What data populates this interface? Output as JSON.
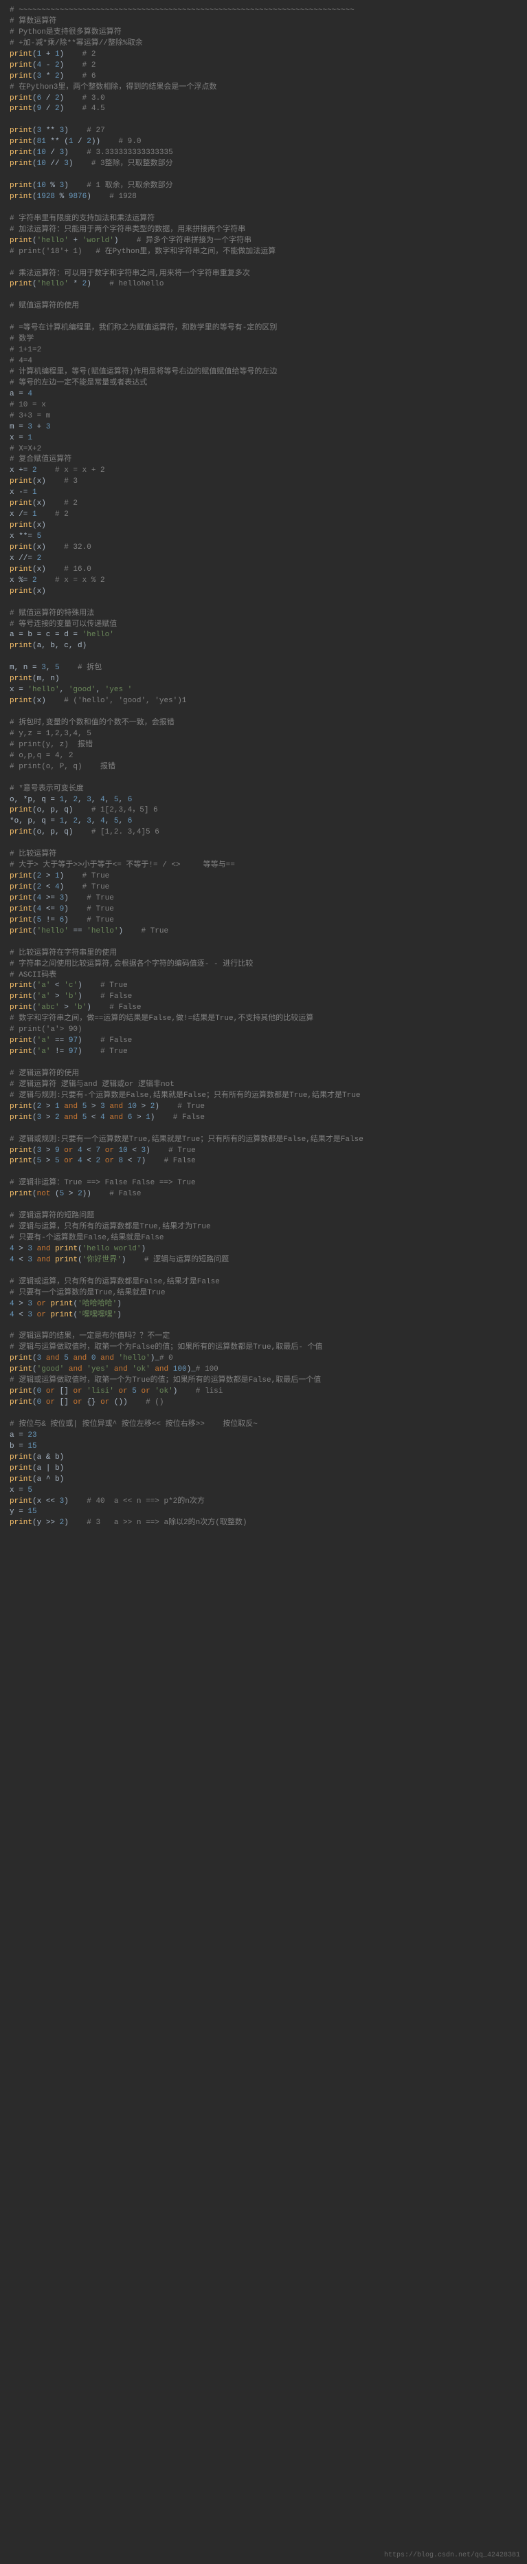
{
  "watermark": "https://blog.csdn.net/qq_42428381",
  "lines": [
    {
      "t": "cmt",
      "v": "# ~~~~~~~~~~~~~~~~~~~~~~~~~~~~~~~~~~~~~~~~~~~~~~~~~~~~~~~~~~~~~~~~~~~~~~~~~~"
    },
    {
      "t": "cmt",
      "v": "# 算数运算符"
    },
    {
      "t": "cmt",
      "v": "# Python是支持很多算数运算符"
    },
    {
      "t": "cmt",
      "v": "# +加-减*乘/除**幂运算//整除%取余"
    },
    {
      "t": "code",
      "v": "print(1 + 1)    # 2"
    },
    {
      "t": "code",
      "v": "print(4 - 2)    # 2"
    },
    {
      "t": "code",
      "v": "print(3 * 2)    # 6",
      "hl": [
        0,
        1
      ]
    },
    {
      "t": "cmt",
      "v": "# 在Python3里，两个整数相除，得到的结果会是一个浮点数"
    },
    {
      "t": "code",
      "v": "print(6 / 2)    # 3.0"
    },
    {
      "t": "code",
      "v": "print(9 / 2)    # 4.5"
    },
    {
      "t": "empty",
      "v": ""
    },
    {
      "t": "code",
      "v": "print(3 ** 3)    # 27"
    },
    {
      "t": "code",
      "v": "print(81 ** (1 / 2))    # 9.0"
    },
    {
      "t": "code",
      "v": "print(10 / 3)    # 3.333333333333335"
    },
    {
      "t": "code",
      "v": "print(10 // 3)    # 3整除，只取整数部分"
    },
    {
      "t": "empty",
      "v": ""
    },
    {
      "t": "code",
      "v": "print(10 % 3)    # 1 取余，只取余数部分"
    },
    {
      "t": "code",
      "v": "print(1928 % 9876)    # 1928"
    },
    {
      "t": "empty",
      "v": ""
    },
    {
      "t": "cmt",
      "v": "# 字符串里有限度的支持加法和乘法运算符"
    },
    {
      "t": "cmt",
      "v": "# 加法运算符：只能用于两个字符串类型的数据，用来拼接两个字符串"
    },
    {
      "t": "code",
      "v": "print('hello' + 'world')    # 异多个字符串拼接为一个字符串"
    },
    {
      "t": "cmt",
      "v": "# print('18'+ 1)   # 在Python里，数字和字符串之间，不能做加法运算"
    },
    {
      "t": "empty",
      "v": ""
    },
    {
      "t": "cmt",
      "v": "# 乘法运算符：可以用于数字和字符串之间,用来将一个字符串重复多次"
    },
    {
      "t": "code",
      "v": "print('hello' * 2)    # hellohello"
    },
    {
      "t": "empty",
      "v": ""
    },
    {
      "t": "cmt",
      "v": "# 赋值运算符的使用"
    },
    {
      "t": "empty",
      "v": ""
    },
    {
      "t": "cmt",
      "v": "# =等号在计算机编程里，我们称之为赋值运算符，和数学里的等号有-定的区别"
    },
    {
      "t": "cmt",
      "v": "# 数学"
    },
    {
      "t": "cmt",
      "v": "# 1+1=2"
    },
    {
      "t": "cmt",
      "v": "# 4=4"
    },
    {
      "t": "cmt",
      "v": "# 计算机编程里，等号(赋值运算符)作用是将等号右边的赋值赋值给等号的左边"
    },
    {
      "t": "cmt",
      "v": "# 等号的左边一定不能是常量或者表达式"
    },
    {
      "t": "code",
      "v": "a = 4"
    },
    {
      "t": "cmt",
      "v": "# 10 = x"
    },
    {
      "t": "cmt",
      "v": "# 3+3 = m"
    },
    {
      "t": "code",
      "v": "m = 3 + 3"
    },
    {
      "t": "code",
      "v": "x = 1"
    },
    {
      "t": "cmt",
      "v": "# X=X+2"
    },
    {
      "t": "cmt",
      "v": "# 复合赋值运算符"
    },
    {
      "t": "code",
      "v": "x += 2    # x = x + 2"
    },
    {
      "t": "code",
      "v": "print(x)    # 3"
    },
    {
      "t": "code",
      "v": "x -= 1"
    },
    {
      "t": "code",
      "v": "print(x)    # 2"
    },
    {
      "t": "code",
      "v": "x /= 1    # 2"
    },
    {
      "t": "code",
      "v": "print(x)"
    },
    {
      "t": "code",
      "v": "x **= 5"
    },
    {
      "t": "code",
      "v": "print(x)    # 32.0"
    },
    {
      "t": "code",
      "v": "x //= 2"
    },
    {
      "t": "code",
      "v": "print(x)    # 16.0"
    },
    {
      "t": "code",
      "v": "x %= 2    # x = x % 2"
    },
    {
      "t": "code",
      "v": "print(x)"
    },
    {
      "t": "empty",
      "v": ""
    },
    {
      "t": "cmt",
      "v": "# 赋值运算符的特殊用法"
    },
    {
      "t": "cmt",
      "v": "# 等号连接的变量可以传递赋值"
    },
    {
      "t": "code",
      "v": "a = b = c = d = 'hello'"
    },
    {
      "t": "code",
      "v": "print(a, b, c, d)"
    },
    {
      "t": "empty",
      "v": ""
    },
    {
      "t": "code",
      "v": "m, n = 3, 5    # 拆包"
    },
    {
      "t": "code",
      "v": "print(m, n)"
    },
    {
      "t": "code",
      "v": "x = 'hello', 'good', 'yes '"
    },
    {
      "t": "code",
      "v": "print(x)    # ('hello', 'good', 'yes')1"
    },
    {
      "t": "empty",
      "v": ""
    },
    {
      "t": "cmt",
      "v": "# 拆包时,变量的个数和值的个数不一致，会报错"
    },
    {
      "t": "cmt",
      "v": "# y,z = 1,2,3,4, 5"
    },
    {
      "t": "cmt",
      "v": "# print(y, z)  报错"
    },
    {
      "t": "cmt",
      "v": "# o,p,q = 4, 2"
    },
    {
      "t": "cmt",
      "v": "# print(o, P, q)    报错"
    },
    {
      "t": "empty",
      "v": ""
    },
    {
      "t": "cmt",
      "v": "# *意号表示可变长度"
    },
    {
      "t": "code",
      "v": "o, *p, q = 1, 2, 3, 4, 5, 6"
    },
    {
      "t": "code",
      "v": "print(o, p, q)    # 1[2,3,4，5] 6"
    },
    {
      "t": "code",
      "v": "*o, p, q = 1, 2, 3, 4, 5, 6"
    },
    {
      "t": "code",
      "v": "print(o, p, q)    # [1,2. 3,4]5 6"
    },
    {
      "t": "empty",
      "v": ""
    },
    {
      "t": "cmt",
      "v": "# 比较运算符"
    },
    {
      "t": "cmt",
      "v": "# 大于> 大于等于>>小于等于<= 不等于!= / <>     等等与=="
    },
    {
      "t": "code",
      "v": "print(2 > 1)    # True"
    },
    {
      "t": "code",
      "v": "print(2 < 4)    # True"
    },
    {
      "t": "code",
      "v": "print(4 >= 3)    # True"
    },
    {
      "t": "code",
      "v": "print(4 <= 9)    # True"
    },
    {
      "t": "code",
      "v": "print(5 != 6)    # True"
    },
    {
      "t": "code",
      "v": "print('hello' == 'hello')    # True"
    },
    {
      "t": "empty",
      "v": ""
    },
    {
      "t": "cmt",
      "v": "# 比较运算符在字符串里的使用"
    },
    {
      "t": "cmt",
      "v": "# 字符串之间使用比较运算符,会根据各个字符的编码值逐- - 进行比较"
    },
    {
      "t": "cmt",
      "v": "# ASCII码表"
    },
    {
      "t": "code",
      "v": "print('a' < 'c')    # True"
    },
    {
      "t": "code",
      "v": "print('a' > 'b')    # False"
    },
    {
      "t": "code",
      "v": "print('abc' > 'b')    # False"
    },
    {
      "t": "cmt",
      "v": "# 数字和字符串之间，做==运算的结果是False,做!=结果是True,不支持其他的比较运算"
    },
    {
      "t": "cmt",
      "v": "# print('a'> 90)"
    },
    {
      "t": "code",
      "v": "print('a' == 97)    # False"
    },
    {
      "t": "code",
      "v": "print('a' != 97)    # True"
    },
    {
      "t": "empty",
      "v": ""
    },
    {
      "t": "cmt",
      "v": "# 逻辑运算符的使用"
    },
    {
      "t": "cmt",
      "v": "# 逻辑运算符 逻辑与and 逻辑或or 逻辑非not"
    },
    {
      "t": "cmt",
      "v": "# 逻辑与规则:只要有-个运算数是False,结果就是False；只有所有的运算数都是True,结果才是True"
    },
    {
      "t": "code",
      "v": "print(2 > 1 and 5 > 3 and 10 > 2)    # True"
    },
    {
      "t": "code",
      "v": "print(3 > 2 and 5 < 4 and 6 > 1)    # False"
    },
    {
      "t": "empty",
      "v": ""
    },
    {
      "t": "cmt",
      "v": "# 逻辑或规则:只要有一个运算数是True,结果就是True；只有所有的运算数都是False,结果才是False"
    },
    {
      "t": "code",
      "v": "print(3 > 9 or 4 < 7 or 10 < 3)    # True"
    },
    {
      "t": "code",
      "v": "print(5 > 5 or 4 < 2 or 8 < 7)    # False"
    },
    {
      "t": "empty",
      "v": ""
    },
    {
      "t": "cmt",
      "v": "# 逻辑非运算：True ==> False False ==> True"
    },
    {
      "t": "code",
      "v": "print(not (5 > 2))    # False"
    },
    {
      "t": "empty",
      "v": ""
    },
    {
      "t": "cmt",
      "v": "# 逻辑运算符的短路问题"
    },
    {
      "t": "cmt",
      "v": "# 逻辑与运算，只有所有的运算数都是True,结果才为True"
    },
    {
      "t": "cmt",
      "v": "# 只要有-个运算数是False,结果就是False"
    },
    {
      "t": "code",
      "v": "4 > 3 and print('hello world')"
    },
    {
      "t": "code",
      "v": "4 < 3 and print('你好世界')    # 逻辑与运算的短路问题"
    },
    {
      "t": "empty",
      "v": ""
    },
    {
      "t": "cmt",
      "v": "# 逻辑或运算，只有所有的运算数都是False,结果才是False"
    },
    {
      "t": "cmt",
      "v": "# 只要有一个运算数的是True,结果就是True"
    },
    {
      "t": "code",
      "v": "4 > 3 or print('哈哈哈哈')"
    },
    {
      "t": "code",
      "v": "4 < 3 or print('嘿嘿嘿嘿')"
    },
    {
      "t": "empty",
      "v": ""
    },
    {
      "t": "cmt",
      "v": "# 逻辑运算的结果，一定是布尔值吗？？不一定"
    },
    {
      "t": "cmt",
      "v": "# 逻辑与运算做取值时，取第一个为False的值；如果所有的运算数都是True,取最后- 个值"
    },
    {
      "t": "code",
      "v": "print(3 and 5 and 0 and 'hello')_# 0"
    },
    {
      "t": "code",
      "v": "print('good' and 'yes' and 'ok' and 100)_# 100"
    },
    {
      "t": "cmt",
      "v": "# 逻辑或运算做取值时，取第一个为True的值；如果所有的运算数都是False,取最后一个值"
    },
    {
      "t": "code",
      "v": "print(0 or [] or 'lisi' or 5 or 'ok')    # lisi"
    },
    {
      "t": "code",
      "v": "print(0 or [] or {} or ())    # ()"
    },
    {
      "t": "empty",
      "v": ""
    },
    {
      "t": "cmt",
      "v": "# 按位与& 按位或| 按位异或^ 按位左移<< 按位右移>>    按位取反~"
    },
    {
      "t": "code",
      "v": "a = 23"
    },
    {
      "t": "code",
      "v": "b = 15    "
    },
    {
      "t": "code",
      "v": "print(a & b)"
    },
    {
      "t": "code",
      "v": "print(a | b)"
    },
    {
      "t": "code",
      "v": "print(a ^ b)"
    },
    {
      "t": "code",
      "v": "x = 5"
    },
    {
      "t": "code",
      "v": "print(x << 3)    # 40  a << n ==> p*2的n次方"
    },
    {
      "t": "code",
      "v": "y = 15"
    },
    {
      "t": "code",
      "v": "print(y >> 2)    # 3   a >> n ==> a除以2的n次方(取整数)"
    }
  ]
}
